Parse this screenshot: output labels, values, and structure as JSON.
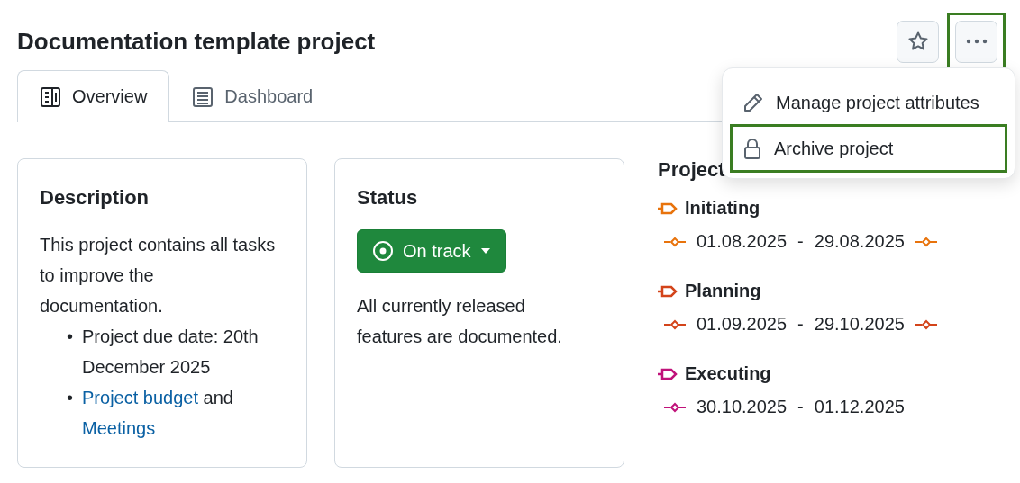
{
  "title": "Documentation template project",
  "header_buttons": [
    {
      "kind": "star",
      "highlighted": false
    },
    {
      "kind": "more",
      "highlighted": true
    }
  ],
  "tabs": [
    {
      "label": "Overview",
      "kind": "book",
      "selected": true
    },
    {
      "label": "Dashboard",
      "kind": "list",
      "selected": false
    }
  ],
  "description": {
    "heading": "Description",
    "text": "This project contains all tasks to improve the documentation.",
    "bullets": [
      {
        "marker": "•",
        "parts": [
          {
            "text": "Project due date: 20th December 2025",
            "link": false
          }
        ]
      },
      {
        "marker": "•",
        "parts": [
          {
            "text": "Project budget",
            "link": true
          },
          {
            "text": " and ",
            "link": false
          },
          {
            "text": "Meetings",
            "link": true
          }
        ]
      }
    ]
  },
  "status": {
    "heading": "Status",
    "button": "On track",
    "text": "All currently released features are documented."
  },
  "lifecycle": {
    "heading": "Project",
    "phases": [
      {
        "name": "Initiating",
        "color": "#e8730c",
        "start": "01.08.2025",
        "separator": "-",
        "end": "29.08.2025",
        "end_marker": true
      },
      {
        "name": "Planning",
        "color": "#d3441a",
        "start": "01.09.2025",
        "separator": "-",
        "end": "29.10.2025",
        "end_marker": true
      },
      {
        "name": "Executing",
        "color": "#c0127a",
        "start": "30.10.2025",
        "separator": "-",
        "end": "01.12.2025",
        "end_marker": false
      }
    ]
  },
  "menu": [
    {
      "label": "Manage project attributes",
      "kind": "pencil",
      "highlighted": false
    },
    {
      "label": "Archive project",
      "kind": "lock",
      "highlighted": true
    }
  ]
}
